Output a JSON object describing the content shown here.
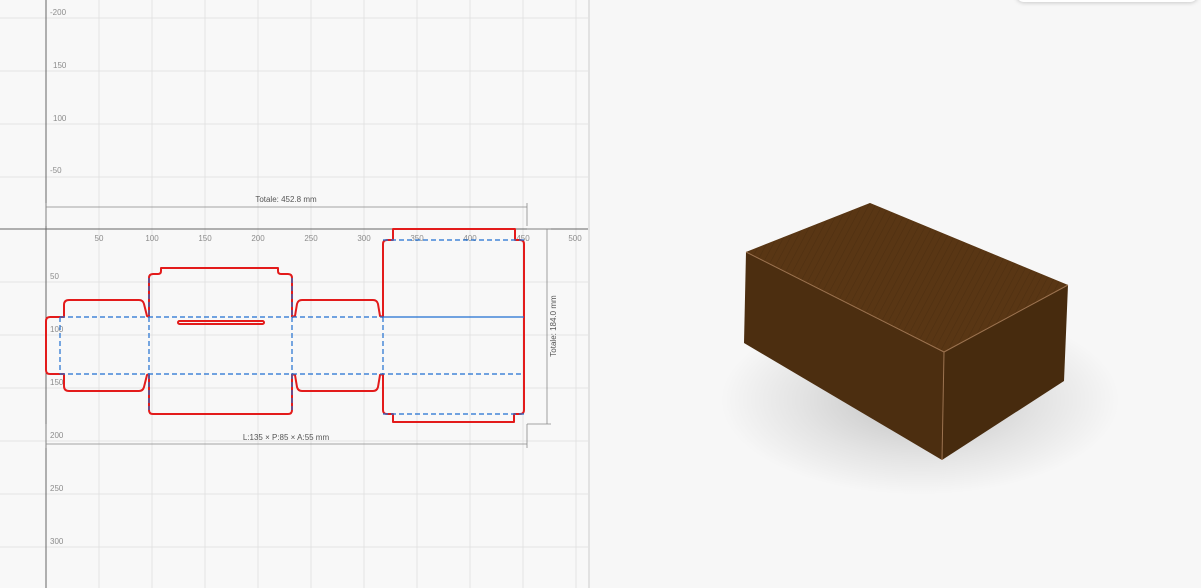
{
  "dieline": {
    "ruler_h_labels": [
      "50",
      "100",
      "150",
      "200",
      "250",
      "300",
      "350",
      "400",
      "450",
      "500"
    ],
    "ruler_v_labels": [
      "-200",
      "150",
      "100",
      "-50",
      "50",
      "100",
      "150",
      "200",
      "250",
      "300"
    ],
    "total_width_label": "Totale: 452.8 mm",
    "total_height_label": "Totale: 184.0 mm",
    "box_dimensions_label": "L:135 × P:85 × A:55 mm",
    "colors": {
      "cut_line": "#e31b1b",
      "fold_line": "#1f6fd1",
      "grid": "#e3e3e3",
      "axis": "#666666"
    }
  },
  "preview": {
    "box_colors": {
      "top": "#5a3715",
      "front": "#4c2e10",
      "side": "#3e250c",
      "edge": "#9c7350"
    },
    "icon": "cardboard-box-3d-icon"
  }
}
